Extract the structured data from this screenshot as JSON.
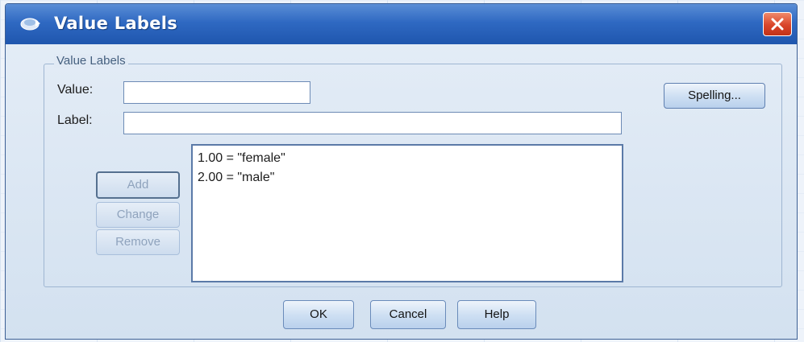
{
  "window": {
    "title": "Value Labels",
    "icon": "dialog-app-icon",
    "close_icon": "close-icon"
  },
  "group": {
    "legend": "Value Labels"
  },
  "fields": {
    "value_label": "Value:",
    "value_input": "",
    "label_label": "Label:",
    "label_input": ""
  },
  "buttons": {
    "spelling": "Spelling...",
    "add": "Add",
    "change": "Change",
    "remove": "Remove",
    "ok": "OK",
    "cancel": "Cancel",
    "help": "Help"
  },
  "list": {
    "items": [
      "1.00 = \"female\"",
      "2.00 = \"male\""
    ]
  },
  "colors": {
    "titlebar": "#2f69c2",
    "close_button": "#d9452a",
    "dialog_background": "#d7e4f2"
  }
}
